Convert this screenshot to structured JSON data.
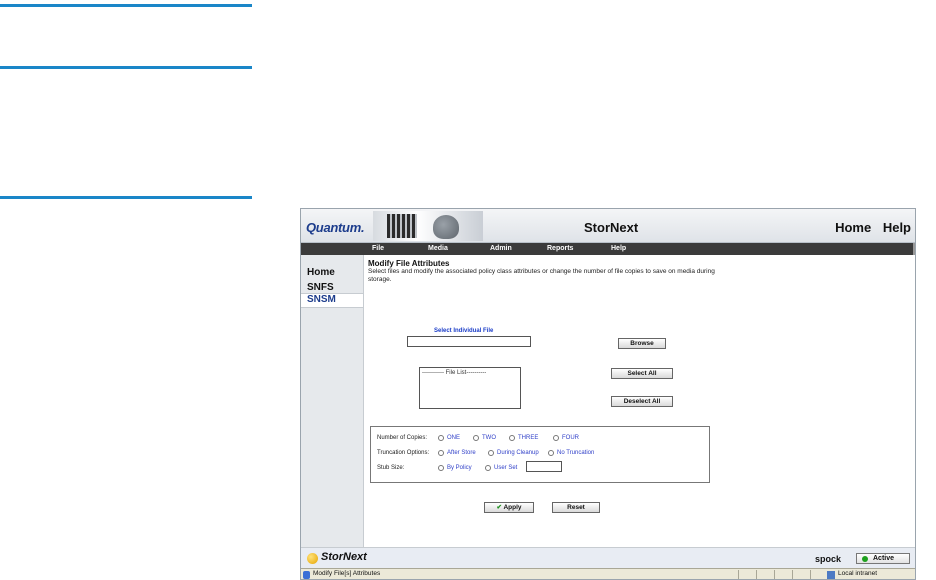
{
  "window": {
    "title": "StorNext"
  },
  "brand": {
    "logo_text": "Quantum.",
    "footer_logo_text": "StorNext"
  },
  "top_nav": {
    "home": "Home",
    "help": "Help"
  },
  "menu": {
    "items": [
      "File",
      "Media",
      "Admin",
      "Reports",
      "Help"
    ]
  },
  "sidebar": {
    "items": [
      "Home",
      "SNFS",
      "SNSM"
    ],
    "active": "SNSM"
  },
  "page": {
    "heading": "Modify File Attributes",
    "description": "Select files and modify the associated policy class attributes or change the number of file copies to save on media during storage."
  },
  "file_select": {
    "label": "Select Individual File",
    "input_value": "",
    "browse_label": "Browse",
    "file_list_placeholder": "----------- File List----------",
    "select_all_label": "Select All",
    "deselect_all_label": "Deselect All"
  },
  "options": {
    "copies_label": "Number of Copies:",
    "copies": [
      "ONE",
      "TWO",
      "THREE",
      "FOUR"
    ],
    "truncation_label": "Truncation Options:",
    "truncation": [
      "After Store",
      "During Cleanup",
      "No Truncation"
    ],
    "stub_label": "Stub Size:",
    "stub": [
      "By Policy",
      "User Set"
    ],
    "stub_value": ""
  },
  "actions": {
    "apply_label": "Apply",
    "reset_label": "Reset"
  },
  "footer": {
    "host": "spock",
    "status": "Active",
    "status_color": "#1ea11e"
  },
  "statusbar": {
    "message": "Modify File[s] Attributes",
    "zone": "Local intranet"
  },
  "colors": {
    "accent_rule": "#1a86c8",
    "menu_bg": "#3b3b3b",
    "link_blue": "#1a3cc8"
  }
}
